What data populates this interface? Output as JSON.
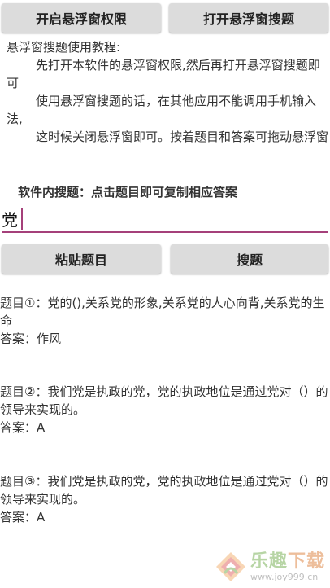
{
  "toolbar": {
    "perm_label": "开启悬浮窗权限",
    "float_label": "打开悬浮窗搜题"
  },
  "tutorial": {
    "title": "悬浮窗搜题使用教程:",
    "step1": "先打开本软件的悬浮窗权限,然后再打开悬浮窗搜题即可",
    "step2": "使用悬浮窗搜题的话，在其他应用不能调用手机输入法,",
    "step3": "这时候关闭悬浮窗即可。按着题目和答案可拖动悬浮窗"
  },
  "search": {
    "section_label": "软件内搜题：点击题目即可复制相应答案",
    "value": "党",
    "paste_label": "粘贴题目",
    "search_label": "搜题"
  },
  "results": [
    {
      "question": "题目①：党的(),关系党的形象,关系党的人心向背,关系党的生命",
      "answer": "答案：作风"
    },
    {
      "question": "题目②：我们党是执政的党，党的执政地位是通过党对（）的领导来实现的。",
      "answer": "答案：A"
    },
    {
      "question": "题目③：我们党是执政的党，党的执政地位是通过党对（）的领导来实现的。",
      "answer": "答案：A"
    }
  ],
  "watermark": {
    "title_a": "乐趣",
    "title_b": "下载",
    "url": "www.joy999.cn"
  },
  "colors": {
    "accent": "#a5407a",
    "button_bg": "#dcdcdc",
    "watermark_green": "#7db35c",
    "watermark_orange": "#e08a4b"
  }
}
